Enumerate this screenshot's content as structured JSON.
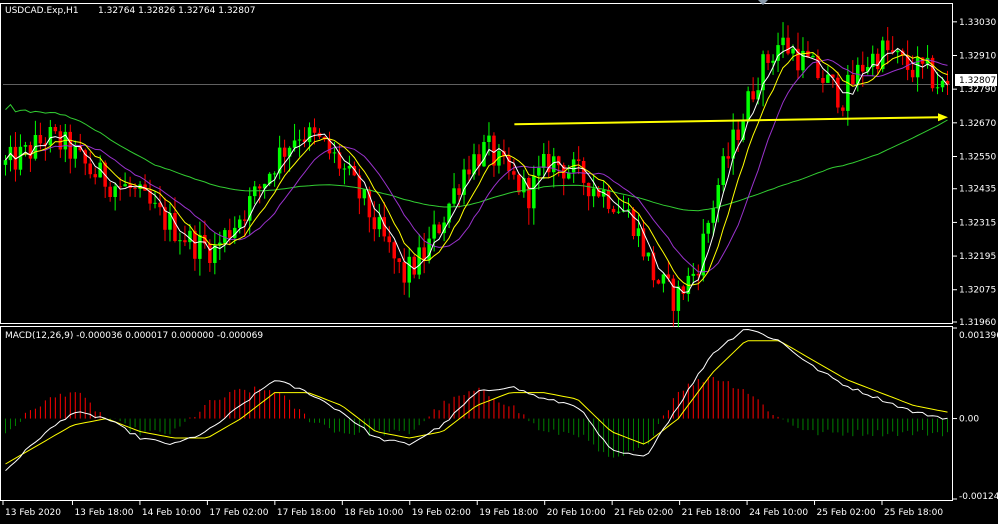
{
  "colors": {
    "background": "#000000",
    "frame": "#ffffff",
    "bull_candle": "#00ff00",
    "bear_candle": "#ff0000",
    "ma_fast": "#ffffff",
    "ma_mid": "#ffff00",
    "ma_slow": "#9932cc",
    "ma_long": "#32cd32",
    "trendline": "#ffff00",
    "price_line": "#808080",
    "macd_line": "#ffffff",
    "signal_line": "#ffff00",
    "hist_pos": "#ff0000",
    "hist_neg": "#008000"
  },
  "chart_data": [
    {
      "type": "candlestick",
      "symbol_label": "USDCAD.Exp,H1",
      "ohlc_label": "1.32764 1.32826 1.32764 1.32807",
      "current_price_label": "1.32807",
      "current_price": 1.32807,
      "ylim": [
        1.3196,
        1.3309
      ],
      "y_ticks": [
        "1.33030",
        "1.32910",
        "1.32790",
        "1.32670",
        "1.32550",
        "1.32435",
        "1.32315",
        "1.32195",
        "1.32075",
        "1.31960"
      ],
      "x_ticks": [
        "13 Feb 2020",
        "13 Feb 18:00",
        "14 Feb 10:00",
        "17 Feb 02:00",
        "17 Feb 18:00",
        "18 Feb 10:00",
        "19 Feb 02:00",
        "19 Feb 18:00",
        "20 Feb 10:00",
        "21 Feb 02:00",
        "21 Feb 18:00",
        "24 Feb 10:00",
        "25 Feb 02:00",
        "25 Feb 18:00"
      ],
      "price_path": [
        1.3252,
        1.3256,
        1.3262,
        1.3258,
        1.325,
        1.3246,
        1.3243,
        1.3236,
        1.323,
        1.3224,
        1.3222,
        1.3232,
        1.3242,
        1.3255,
        1.3264,
        1.326,
        1.3252,
        1.324,
        1.3226,
        1.3212,
        1.322,
        1.3235,
        1.3252,
        1.3258,
        1.3248,
        1.3242,
        1.3254,
        1.325,
        1.3245,
        1.324,
        1.3232,
        1.3212,
        1.3204,
        1.3215,
        1.3244,
        1.3265,
        1.3285,
        1.3296,
        1.329,
        1.3283,
        1.3276,
        1.3288,
        1.3293,
        1.3287,
        1.3285,
        1.3278
      ],
      "trendline": {
        "start": 1.32665,
        "end": 1.3269
      }
    },
    {
      "type": "macd",
      "label": "MACD(12,26,9) -0.000036 0.000017 0.000000 -0.000069",
      "ylim": [
        -0.00124,
        0.001396
      ],
      "y_ticks": [
        "0.001396",
        "0.00",
        "-0.00124"
      ],
      "macd_path": [
        -0.0008,
        -0.0003,
        0.0001,
        0.0,
        -0.0003,
        -0.0004,
        -0.0002,
        0.0002,
        0.0006,
        0.0004,
        0.0001,
        -0.0003,
        -0.0004,
        -0.0001,
        0.0004,
        0.0005,
        0.0003,
        0.0002,
        -0.0005,
        -0.0006,
        0.0002,
        0.001,
        0.0014,
        0.0012,
        0.0008,
        0.0005,
        0.0003,
        0.0001,
        0.0
      ],
      "signal_path": [
        -0.0007,
        -0.0004,
        -0.0001,
        0.0,
        -0.0002,
        -0.0003,
        -0.0003,
        0.0,
        0.0004,
        0.0004,
        0.0002,
        -0.0002,
        -0.0003,
        -0.0002,
        0.0002,
        0.0004,
        0.0004,
        0.0003,
        -0.0002,
        -0.0004,
        0.0,
        0.0007,
        0.0012,
        0.0012,
        0.0009,
        0.0006,
        0.0004,
        0.0002,
        0.0001
      ]
    }
  ]
}
